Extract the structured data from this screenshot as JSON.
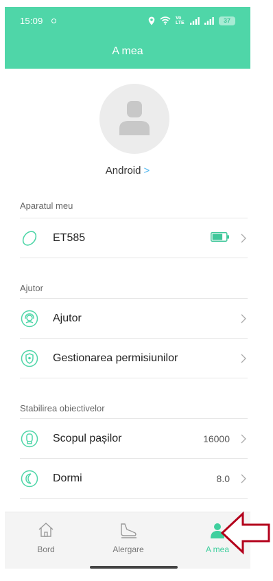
{
  "status_bar": {
    "time": "15:09",
    "volte_label": "Vo LTE",
    "battery_level": "37"
  },
  "header": {
    "title": "A mea"
  },
  "profile": {
    "name": "Android",
    "chevron": ">"
  },
  "sections": [
    {
      "title": "Aparatul meu",
      "items": [
        {
          "icon": "watch-icon",
          "label": "ET585",
          "value": "",
          "battery_fill": 0.75
        }
      ]
    },
    {
      "title": "Ajutor",
      "items": [
        {
          "icon": "headset-icon",
          "label": "Ajutor",
          "value": ""
        },
        {
          "icon": "shield-icon",
          "label": "Gestionarea permisiunilor",
          "value": ""
        }
      ]
    },
    {
      "title": "Stabilirea obiectivelor",
      "items": [
        {
          "icon": "footprint-icon",
          "label": "Scopul pașilor",
          "value": "16000"
        },
        {
          "icon": "moon-icon",
          "label": "Dormi",
          "value": "8.0"
        }
      ]
    }
  ],
  "tabs": [
    {
      "icon": "home-icon",
      "label": "Bord",
      "active": false
    },
    {
      "icon": "shoe-icon",
      "label": "Alergare",
      "active": false
    },
    {
      "icon": "person-icon",
      "label": "A mea",
      "active": true
    }
  ],
  "colors": {
    "accent": "#4fd6a8",
    "link": "#4fb6f0",
    "annotation": "#b3001b"
  }
}
